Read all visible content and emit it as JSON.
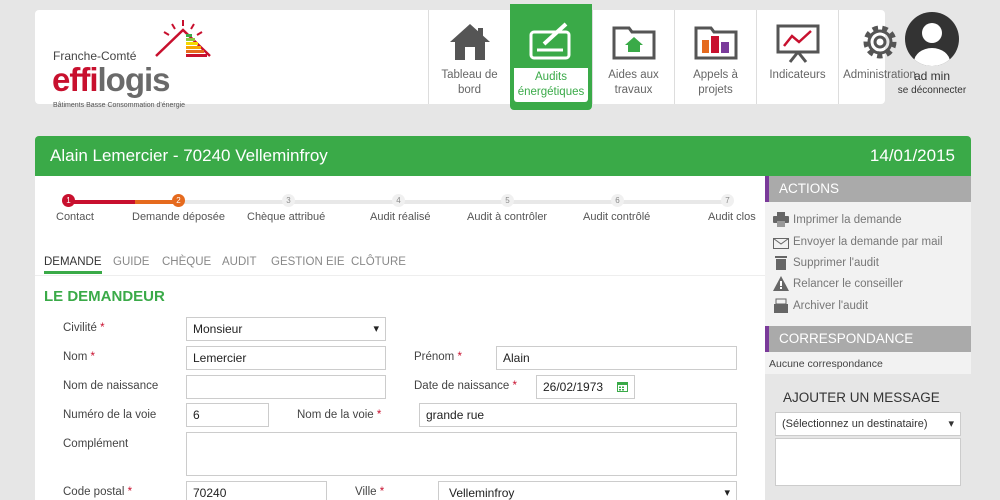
{
  "brand": {
    "region": "Franche-Comté",
    "name_a": "effi",
    "name_b": "logis",
    "tagline": "Bâtiments Basse Consommation d'énergie"
  },
  "nav": [
    {
      "label1": "Tableau de",
      "label2": "bord",
      "icon": "house-icon"
    },
    {
      "label1": "Audits",
      "label2": "énergétiques",
      "icon": "check-card-icon"
    },
    {
      "label1": "Aides aux",
      "label2": "travaux",
      "icon": "folder-house-icon"
    },
    {
      "label1": "Appels à projets",
      "label2": "",
      "icon": "folder-buildings-icon"
    },
    {
      "label1": "Indicateurs",
      "label2": "",
      "icon": "presentation-chart-icon"
    },
    {
      "label1": "Administration",
      "label2": "",
      "icon": "gear-icon"
    }
  ],
  "user": {
    "name": "ad min",
    "logout": "se déconnecter"
  },
  "banner": {
    "name": "Alain Lemercier",
    "location": " - 70240 Velleminfroy",
    "date": "14/01/2015"
  },
  "steps": [
    {
      "num": "1",
      "label": "Contact"
    },
    {
      "num": "2",
      "label": "Demande déposée"
    },
    {
      "num": "3",
      "label": "Chèque attribué"
    },
    {
      "num": "4",
      "label": "Audit réalisé"
    },
    {
      "num": "5",
      "label": "Audit à contrôler"
    },
    {
      "num": "6",
      "label": "Audit contrôlé"
    },
    {
      "num": "7",
      "label": "Audit clos"
    }
  ],
  "tabs": [
    "DEMANDE",
    "GUIDE",
    "CHÈQUE",
    "AUDIT",
    "GESTION EIE",
    "CLÔTURE"
  ],
  "section_title": "LE DEMANDEUR",
  "form": {
    "civilite_label": "Civilité",
    "civilite_value": "Monsieur",
    "nom_label": "Nom",
    "nom_value": "Lemercier",
    "prenom_label": "Prénom",
    "prenom_value": "Alain",
    "nom_naissance_label": "Nom de naissance",
    "nom_naissance_value": "",
    "date_naissance_label": "Date de naissance",
    "date_naissance_value": "26/02/1973",
    "num_voie_label": "Numéro de la voie",
    "num_voie_value": "6",
    "nom_voie_label": "Nom de la voie",
    "nom_voie_value": "grande rue",
    "complement_label": "Complément",
    "complement_value": "",
    "cp_label": "Code postal",
    "cp_value": "70240",
    "ville_label": "Ville",
    "ville_value": "Velleminfroy",
    "required_mark": "*"
  },
  "actions": {
    "title": "ACTIONS",
    "items": [
      "Imprimer la demande",
      "Envoyer la demande par mail",
      "Supprimer l'audit",
      "Relancer le conseiller",
      "Archiver l'audit"
    ]
  },
  "correspondance": {
    "title": "CORRESPONDANCE",
    "empty": "Aucune correspondance"
  },
  "message": {
    "title": "AJOUTER UN MESSAGE",
    "recipient_placeholder": "(Sélectionnez un destinataire)"
  },
  "colors": {
    "green": "#3aaa48",
    "red": "#c8102e",
    "orange": "#e56a1e",
    "purple": "#7a3a9a"
  }
}
